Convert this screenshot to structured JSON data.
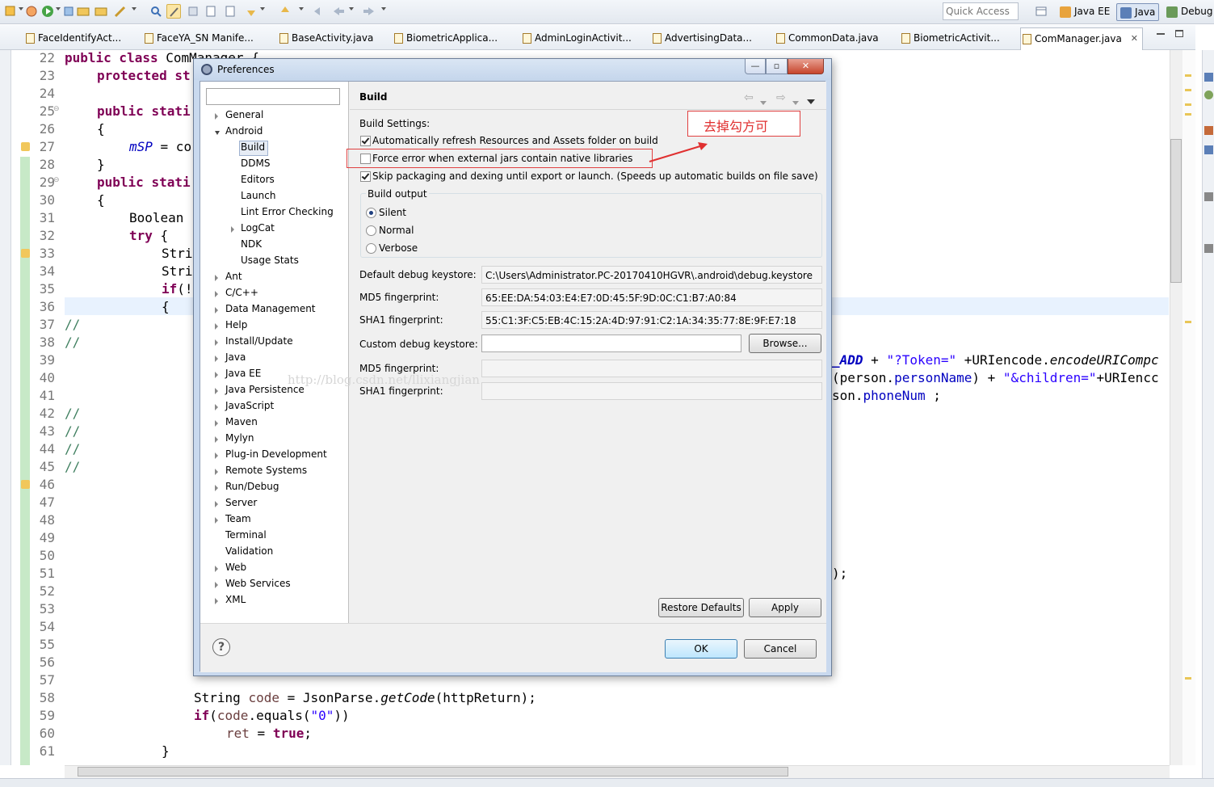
{
  "toolbar": {
    "quick_access_placeholder": "Quick Access",
    "perspectives": [
      {
        "label": "Java EE"
      },
      {
        "label": "Java"
      },
      {
        "label": "Debug"
      }
    ]
  },
  "editor_tabs": [
    {
      "label": "FaceIdentifyAct..."
    },
    {
      "label": "FaceYA_SN Manife..."
    },
    {
      "label": "BaseActivity.java"
    },
    {
      "label": "BiometricApplica..."
    },
    {
      "label": "AdminLoginActivit..."
    },
    {
      "label": "AdvertisingData..."
    },
    {
      "label": "CommonData.java"
    },
    {
      "label": "BiometricActivit..."
    },
    {
      "label": "ComManager.java"
    }
  ],
  "editor": {
    "line_numbers": [
      "22",
      "23",
      "24",
      "25",
      "26",
      "27",
      "28",
      "29",
      "30",
      "31",
      "32",
      "33",
      "34",
      "35",
      "36",
      "37",
      "38",
      "39",
      "40",
      "41",
      "42",
      "43",
      "44",
      "45",
      "46",
      "47",
      "48",
      "49",
      "50",
      "51",
      "52",
      "53",
      "54",
      "55",
      "56",
      "57",
      "58",
      "59",
      "60",
      "61"
    ],
    "lines": {
      "l22a": "public class ",
      "l22b": "ComManager {",
      "l23a": "protected ",
      "l23b": "st",
      "l25a": "public ",
      "l25b": "stati",
      "l26": "{",
      "l27a": "mSP",
      "l27b": " = co",
      "l28": "}",
      "l29a": "public ",
      "l29b": "stati",
      "l30": "{",
      "l31": "Boolean",
      "l32a": "try",
      "l32b": " {",
      "l33": "Stri",
      "l34": "Stri",
      "l35a": "if",
      "l35b": "(!",
      "l36": "{",
      "l37": "//",
      "l38": "//",
      "l39a": "_ADD",
      "l39b": " + ",
      "l39c": "\"?Token=\"",
      "l39d": " +URIencode.",
      "l39e": "encodeURICompc",
      "l40a": "(person.",
      "l40b": "personName",
      "l40c": ") + ",
      "l40d": "\"&children=\"",
      "l40e": "+URIencc",
      "l41a": "son.",
      "l41b": "phoneNum",
      "l41c": " ;",
      "l42": "//",
      "l43": "//",
      "l44": "//",
      "l45": "//",
      "l51": ");",
      "l58a": "String ",
      "l58b": "code",
      "l58c": " = JsonParse.",
      "l58d": "getCode",
      "l58e": "(httpReturn);",
      "l59a": "if",
      "l59b": "(",
      "l59c": "code",
      "l59d": ".equals(",
      "l59e": "\"0\"",
      "l59f": "))",
      "l60a": "ret",
      "l60b": " = ",
      "l60c": "true",
      "l60d": ";",
      "l61": "}"
    }
  },
  "dialog": {
    "title": "Preferences",
    "nav_tree": {
      "general": "General",
      "android": "Android",
      "android_children": [
        "Build",
        "DDMS",
        "Editors",
        "Launch",
        "Lint Error Checking",
        "LogCat",
        "NDK",
        "Usage Stats"
      ],
      "others": [
        "Ant",
        "C/C++",
        "Data Management",
        "Help",
        "Install/Update",
        "Java",
        "Java EE",
        "Java Persistence",
        "JavaScript",
        "Maven",
        "Mylyn",
        "Plug-in Development",
        "Remote Systems",
        "Run/Debug",
        "Server",
        "Team",
        "Terminal",
        "Validation",
        "Web",
        "Web Services",
        "XML"
      ]
    },
    "page": {
      "title": "Build",
      "settings_label": "Build Settings:",
      "checkboxes": [
        {
          "label": "Automatically refresh Resources and Assets folder on build",
          "checked": true
        },
        {
          "label": "Force error when external jars contain native libraries",
          "checked": false
        },
        {
          "label": "Skip packaging and dexing until export or launch. (Speeds up automatic builds on file save)",
          "checked": true
        }
      ],
      "build_output": {
        "label": "Build output",
        "options": [
          {
            "label": "Silent",
            "selected": true
          },
          {
            "label": "Normal",
            "selected": false
          },
          {
            "label": "Verbose",
            "selected": false
          }
        ]
      },
      "default_keystore_label": "Default debug keystore:",
      "default_keystore_value": "C:\\Users\\Administrator.PC-20170410HGVR\\.android\\debug.keystore",
      "md5_label": "MD5 fingerprint:",
      "md5_value": "65:EE:DA:54:03:E4:E7:0D:45:5F:9D:0C:C1:B7:A0:84",
      "sha1_label": "SHA1 fingerprint:",
      "sha1_value": "55:C1:3F:C5:EB:4C:15:2A:4D:97:91:C2:1A:34:35:77:8E:9F:E7:18",
      "custom_keystore_label": "Custom debug keystore:",
      "custom_keystore_value": "",
      "custom_md5_label": "MD5 fingerprint:",
      "custom_sha1_label": "SHA1 fingerprint:",
      "browse_label": "Browse...",
      "restore_defaults_label": "Restore Defaults",
      "apply_label": "Apply"
    },
    "ok_label": "OK",
    "cancel_label": "Cancel"
  },
  "watermark": "http://blog.csdn.net/llixiangjian",
  "annotation": {
    "text": "去掉勾方可",
    "color": "#e03030"
  },
  "colors": {
    "keyword": "#7f0055",
    "string": "#2a00ff",
    "field": "#0000c0",
    "comment": "#3f7f5f"
  }
}
